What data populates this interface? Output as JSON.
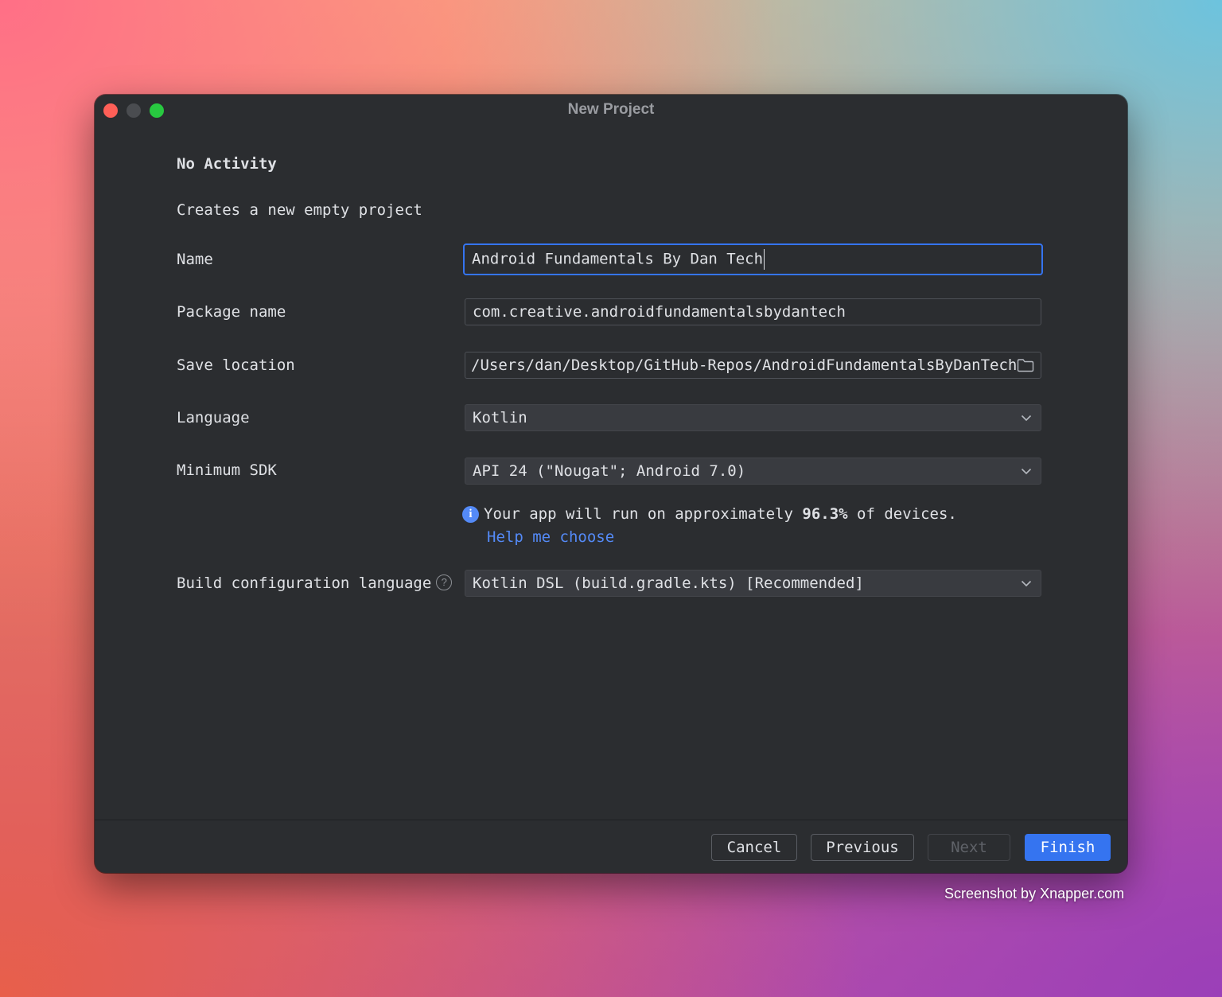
{
  "window": {
    "title": "New Project"
  },
  "template": {
    "heading": "No Activity",
    "description": "Creates a new empty project"
  },
  "form": {
    "name": {
      "label": "Name",
      "value": "Android Fundamentals By Dan Tech"
    },
    "package": {
      "label": "Package name",
      "value": "com.creative.androidfundamentalsbydantech"
    },
    "save_location": {
      "label": "Save location",
      "value": "/Users/dan/Desktop/GitHub-Repos/AndroidFundamentalsByDanTech"
    },
    "language": {
      "label": "Language",
      "value": "Kotlin"
    },
    "min_sdk": {
      "label": "Minimum SDK",
      "value": "API 24 (\"Nougat\"; Android 7.0)"
    },
    "info": {
      "prefix": "Your app will run on approximately ",
      "percent": "96.3%",
      "suffix": " of devices.",
      "link": "Help me choose"
    },
    "build_config": {
      "label": "Build configuration language",
      "value": "Kotlin DSL (build.gradle.kts) [Recommended]"
    }
  },
  "buttons": {
    "cancel": "Cancel",
    "previous": "Previous",
    "next": "Next",
    "finish": "Finish"
  },
  "icons": {
    "info": "info-icon",
    "help": "question-circle-icon",
    "folder": "folder-icon",
    "dropdown": "chevron-down-icon"
  },
  "colors": {
    "accent": "#3574f0",
    "link": "#548af7",
    "window_bg": "#2b2d30",
    "text": "#dfe1e5"
  },
  "watermark": "Screenshot by Xnapper.com"
}
